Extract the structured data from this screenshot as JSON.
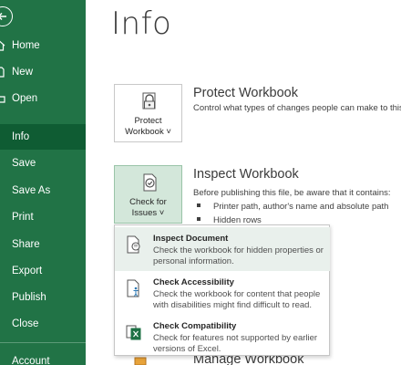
{
  "sidebar": {
    "items": [
      {
        "label": "Home",
        "icon": "home-icon"
      },
      {
        "label": "New",
        "icon": "new-document-icon"
      },
      {
        "label": "Open",
        "icon": "folder-open-icon"
      },
      {
        "label": "Info"
      },
      {
        "label": "Save"
      },
      {
        "label": "Save As"
      },
      {
        "label": "Print"
      },
      {
        "label": "Share"
      },
      {
        "label": "Export"
      },
      {
        "label": "Publish"
      },
      {
        "label": "Close"
      },
      {
        "label": "Account"
      }
    ],
    "selected": "Info",
    "color": "#217346",
    "selected_color": "#0f5c33"
  },
  "page": {
    "title": "Info"
  },
  "protect": {
    "tile_line1": "Protect",
    "tile_line2": "Workbook ˅",
    "title": "Protect Workbook",
    "desc": "Control what types of changes people can make to this"
  },
  "inspect": {
    "tile_line1": "Check for",
    "tile_line2": "Issues ˅",
    "title": "Inspect Workbook",
    "desc": "Before publishing this file, be aware that it contains:",
    "bullets": [
      "Printer path, author's name and absolute path",
      "Hidden rows"
    ]
  },
  "menu": {
    "items": [
      {
        "title": "Inspect Document",
        "desc": "Check the workbook for hidden properties or personal information.",
        "icon": "inspect-document-icon"
      },
      {
        "title": "Check Accessibility",
        "desc": "Check the workbook for content that people with disabilities might find difficult to read.",
        "icon": "accessibility-icon"
      },
      {
        "title": "Check Compatibility",
        "desc": "Check for features not supported by earlier versions of Excel.",
        "icon": "compatibility-icon"
      }
    ]
  },
  "manage": {
    "title": "Manage Workbook"
  }
}
